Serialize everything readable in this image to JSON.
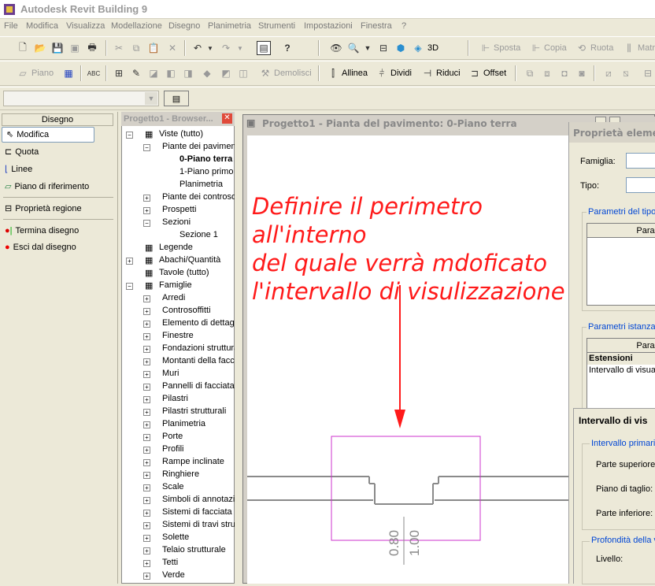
{
  "app": {
    "title": "Autodesk Revit Building 9"
  },
  "menu": [
    "File",
    "Modifica",
    "Visualizza",
    "Modellazione",
    "Disegno",
    "Planimetria",
    "Strumenti",
    "Impostazioni",
    "Finestra",
    "?"
  ],
  "toolbar1": {
    "sposta": "Sposta",
    "copia": "Copia",
    "ruota": "Ruota",
    "matr": "Matr",
    "3d": "3D"
  },
  "toolbar2": {
    "piano": "Piano",
    "demolisci": "Demolisci",
    "allinea": "Allinea",
    "dividi": "Dividi",
    "riduci": "Riduci",
    "offset": "Offset"
  },
  "designbar": {
    "header": "Disegno",
    "tools": [
      "Modifica",
      "Quota",
      "Linee",
      "Piano di riferimento",
      "Proprietà regione",
      "Termina disegno",
      "Esci dal disegno"
    ]
  },
  "browser": {
    "title": "Progetto1 - Browser...",
    "tree": [
      {
        "label": "Viste (tutto)",
        "indent": 0,
        "pm": "-"
      },
      {
        "label": "Piante dei pavimen",
        "indent": 1,
        "pm": "-"
      },
      {
        "label": "0-Piano terra",
        "indent": 2,
        "bold": true
      },
      {
        "label": "1-Piano primo",
        "indent": 2
      },
      {
        "label": "Planimetria",
        "indent": 2
      },
      {
        "label": "Piante dei controso",
        "indent": 1,
        "pm": "+"
      },
      {
        "label": "Prospetti",
        "indent": 1,
        "pm": "+"
      },
      {
        "label": "Sezioni",
        "indent": 1,
        "pm": "-"
      },
      {
        "label": "Sezione 1",
        "indent": 2
      },
      {
        "label": "Legende",
        "indent": 0,
        "pm": ""
      },
      {
        "label": "Abachi/Quantità",
        "indent": 0,
        "pm": "+"
      },
      {
        "label": "Tavole (tutto)",
        "indent": 0,
        "pm": ""
      },
      {
        "label": "Famiglie",
        "indent": 0,
        "pm": "-"
      },
      {
        "label": "Arredi",
        "indent": 1,
        "pm": "+"
      },
      {
        "label": "Controsoffitti",
        "indent": 1,
        "pm": "+"
      },
      {
        "label": "Elemento di dettagl",
        "indent": 1,
        "pm": "+"
      },
      {
        "label": "Finestre",
        "indent": 1,
        "pm": "+"
      },
      {
        "label": "Fondazioni struttura",
        "indent": 1,
        "pm": "+"
      },
      {
        "label": "Montanti della facc",
        "indent": 1,
        "pm": "+"
      },
      {
        "label": "Muri",
        "indent": 1,
        "pm": "+"
      },
      {
        "label": "Pannelli di facciata",
        "indent": 1,
        "pm": "+"
      },
      {
        "label": "Pilastri",
        "indent": 1,
        "pm": "+"
      },
      {
        "label": "Pilastri strutturali",
        "indent": 1,
        "pm": "+"
      },
      {
        "label": "Planimetria",
        "indent": 1,
        "pm": "+"
      },
      {
        "label": "Porte",
        "indent": 1,
        "pm": "+"
      },
      {
        "label": "Profili",
        "indent": 1,
        "pm": "+"
      },
      {
        "label": "Rampe inclinate",
        "indent": 1,
        "pm": "+"
      },
      {
        "label": "Ringhiere",
        "indent": 1,
        "pm": "+"
      },
      {
        "label": "Scale",
        "indent": 1,
        "pm": "+"
      },
      {
        "label": "Simboli di annotazio",
        "indent": 1,
        "pm": "+"
      },
      {
        "label": "Sistemi di facciata c",
        "indent": 1,
        "pm": "+"
      },
      {
        "label": "Sistemi di travi strut",
        "indent": 1,
        "pm": "+"
      },
      {
        "label": "Solette",
        "indent": 1,
        "pm": "+"
      },
      {
        "label": "Telaio strutturale",
        "indent": 1,
        "pm": "+"
      },
      {
        "label": "Tetti",
        "indent": 1,
        "pm": "+"
      },
      {
        "label": "Verde",
        "indent": 1,
        "pm": "+"
      }
    ]
  },
  "view": {
    "title": "Progetto1 - Pianta del pavimento: 0-Piano terra",
    "annotation": [
      "Definire il perimetro all'interno",
      "del quale verrà mdoficato",
      "l'intervallo di visulizzazione"
    ],
    "dim1": "0.80",
    "dim2": "1.00"
  },
  "properties": {
    "title": "Proprietà elemen",
    "famiglia": "Famiglia:",
    "tipo": "Tipo:",
    "param_tipo": "Parametri del tipo:",
    "param_tipo_col": "Para",
    "param_ist": "Parametri istanza: c",
    "param_ist_col": "Para",
    "estensioni": "Estensioni",
    "intervallo": "Intervallo di visua"
  },
  "view_range": {
    "title": "Intervallo di vis",
    "primario": "Intervallo primario",
    "superiore": "Parte superiore:",
    "taglio": "Piano di taglio:",
    "inferiore": "Parte inferiore:",
    "profondita": "Profondità della v",
    "livello": "Livello:"
  },
  "colors": {
    "annotation": "#ff1a1a",
    "region": "#cc33cc"
  }
}
